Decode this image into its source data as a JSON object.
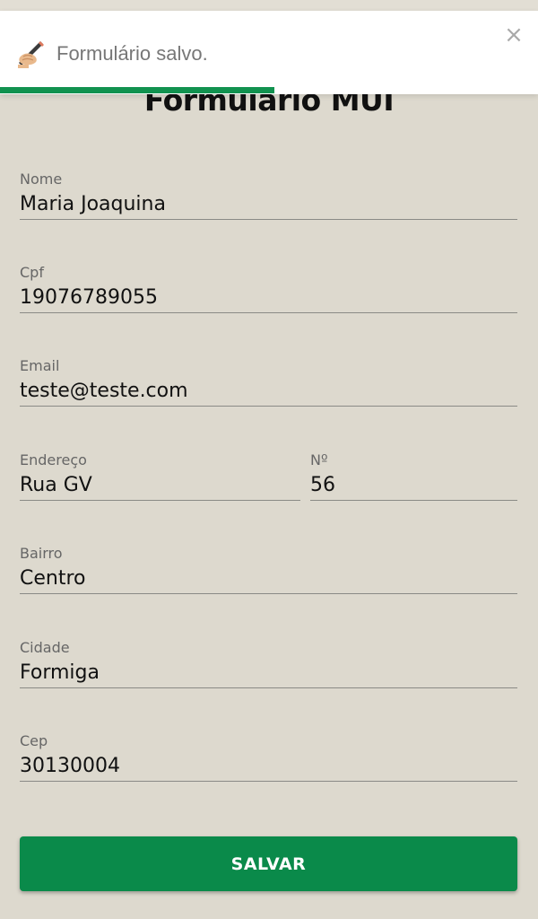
{
  "toast": {
    "message": "Formulário salvo.",
    "close_symbol": "×",
    "icon": "writing-hand-icon",
    "progress": 0.51,
    "progress_color": "#11924f"
  },
  "form": {
    "title": "Formulário MUI",
    "fields": {
      "nome": {
        "label": "Nome",
        "value": "Maria Joaquina"
      },
      "cpf": {
        "label": "Cpf",
        "value": "19076789055"
      },
      "email": {
        "label": "Email",
        "value": "teste@teste.com"
      },
      "endereco": {
        "label": "Endereço",
        "value": "Rua GV"
      },
      "numero": {
        "label": "Nº",
        "value": "56"
      },
      "bairro": {
        "label": "Bairro",
        "value": "Centro"
      },
      "cidade": {
        "label": "Cidade",
        "value": "Formiga"
      },
      "cep": {
        "label": "Cep",
        "value": "30130004"
      }
    },
    "submit_label": "SALVAR"
  },
  "colors": {
    "background": "#ddd9ce",
    "primary": "#0a8a4a",
    "text": "#111111",
    "label": "#666666"
  }
}
